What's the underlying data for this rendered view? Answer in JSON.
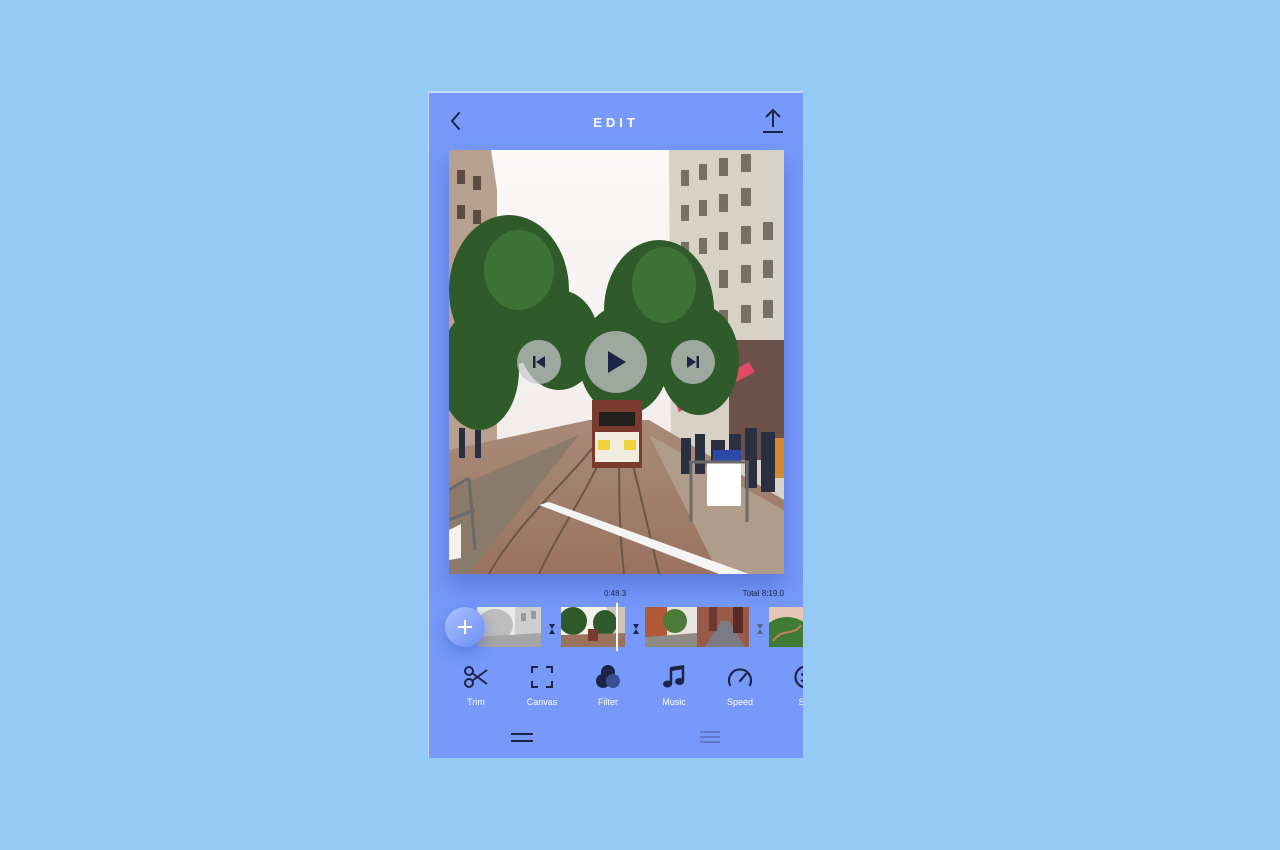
{
  "header": {
    "title": "EDIT",
    "back_icon": "chevron-left-icon",
    "upload_icon": "upload-icon"
  },
  "player": {
    "prev_icon": "skip-previous-icon",
    "play_icon": "play-icon",
    "next_icon": "skip-next-icon"
  },
  "timeline": {
    "current_time": "0:48.3",
    "total_time": "Total 8:19.0",
    "add_icon": "plus-icon",
    "transition_icon": "hourglass-icon"
  },
  "toolbar": {
    "tools": [
      {
        "label": "Trim",
        "icon": "scissors-icon"
      },
      {
        "label": "Canvas",
        "icon": "crop-frame-icon"
      },
      {
        "label": "Filter",
        "icon": "filter-circles-icon"
      },
      {
        "label": "Music",
        "icon": "music-note-icon"
      },
      {
        "label": "Speed",
        "icon": "speedometer-icon"
      },
      {
        "label": "Stic",
        "icon": "sticker-icon"
      }
    ]
  },
  "bottom_nav": {
    "items": [
      {
        "icon": "two-lines-icon",
        "active": true
      },
      {
        "icon": "menu-icon",
        "active": false
      }
    ]
  },
  "colors": {
    "background": "#95caf5",
    "app_background": "#7699fb",
    "icon_dark": "#1c2546"
  }
}
